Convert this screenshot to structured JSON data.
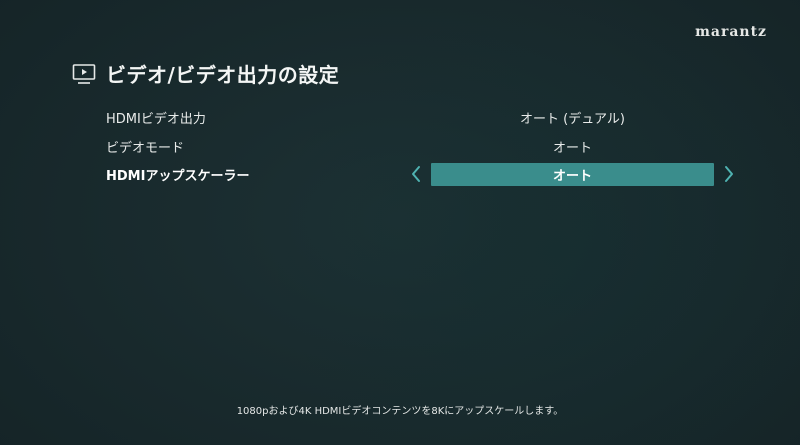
{
  "brand": "marantz",
  "header": {
    "title": "ビデオ/ビデオ出力の設定",
    "icon": "tv-screen-icon"
  },
  "settings": [
    {
      "label": "HDMIビデオ出力",
      "value": "オート (デュアル)"
    },
    {
      "label": "ビデオモード",
      "value": "オート"
    },
    {
      "label": "HDMIアップスケーラー",
      "value": "オート"
    }
  ],
  "hint": "1080pおよび4K HDMIビデオコンテンツを8Kにアップスケールします。",
  "colors": {
    "accent": "#3a8d8c",
    "arrow": "#4fb3b2",
    "background": "#152427"
  }
}
